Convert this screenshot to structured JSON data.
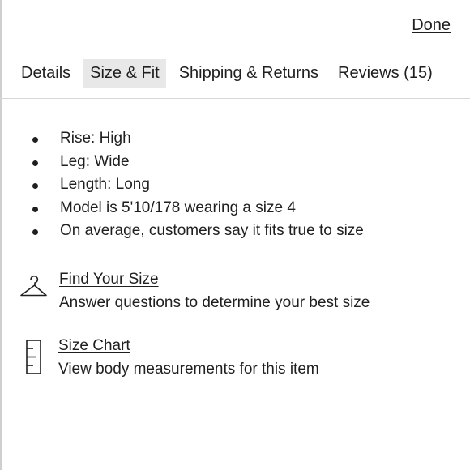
{
  "header": {
    "done_label": "Done"
  },
  "tabs": [
    {
      "label": "Details",
      "active": false
    },
    {
      "label": "Size & Fit",
      "active": true
    },
    {
      "label": "Shipping & Returns",
      "active": false
    },
    {
      "label": "Reviews (15)",
      "active": false
    }
  ],
  "size_fit": {
    "features": [
      "Rise: High",
      "Leg: Wide",
      "Length: Long",
      "Model is 5'10/178 wearing a size 4",
      "On average, customers say it fits true to size"
    ],
    "find_your_size": {
      "icon": "hanger-icon",
      "link_label": "Find Your Size",
      "description": "Answer questions to determine your best size"
    },
    "size_chart": {
      "icon": "ruler-icon",
      "link_label": "Size Chart",
      "description": "View body measurements for this item"
    }
  },
  "colors": {
    "text": "#1f1f1f",
    "active_tab_bg": "#e8e8e8",
    "divider": "#d7d7d7"
  }
}
